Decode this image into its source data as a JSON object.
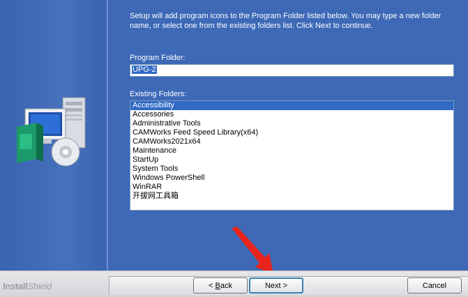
{
  "description": "Setup will add program icons to the Program Folder listed below.  You may type a new folder name, or select one from the existing folders list.  Click Next to continue.",
  "program_folder": {
    "label": "Program Folder:",
    "value": "UPG-2"
  },
  "existing_folders": {
    "label": "Existing Folders:",
    "items": [
      "Accessibility",
      "Accessories",
      "Administrative Tools",
      "CAMWorks Feed Speed Library(x64)",
      "CAMWorks2021x64",
      "Maintenance",
      "StartUp",
      "System Tools",
      "Windows PowerShell",
      "WinRAR",
      "开拔网工具箱"
    ],
    "selected_index": 0
  },
  "footer": {
    "brand_bold": "Install",
    "brand_thin": "Shield",
    "back_prefix": "< ",
    "back_key": "B",
    "back_rest": "ack",
    "next_label": "Next >",
    "cancel_label": "Cancel"
  },
  "colors": {
    "background": "#3d69b7",
    "selection": "#316ac5",
    "annotation_arrow": "#e8241c"
  }
}
